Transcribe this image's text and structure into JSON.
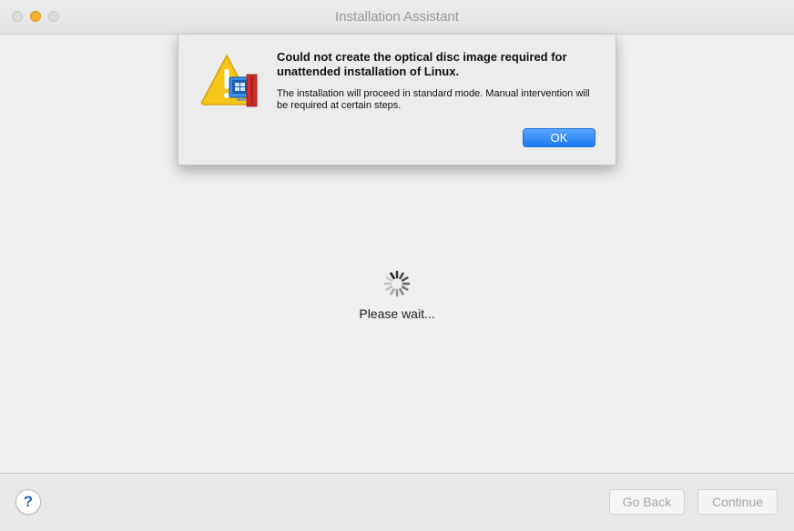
{
  "window": {
    "title": "Installation Assistant"
  },
  "main": {
    "status_text": "Please wait..."
  },
  "footer": {
    "help_label": "?",
    "go_back_label": "Go Back",
    "continue_label": "Continue"
  },
  "alert": {
    "icon": "warning-with-vm-icon",
    "title": "Could not create the optical disc image required for unattended installation of Linux.",
    "message": "The installation will proceed in standard mode. Manual intervention will be required at certain steps.",
    "ok_label": "OK"
  },
  "colors": {
    "accent": "#1c78f0",
    "minimize": "#f5b12e",
    "warning": "#f5c518"
  }
}
